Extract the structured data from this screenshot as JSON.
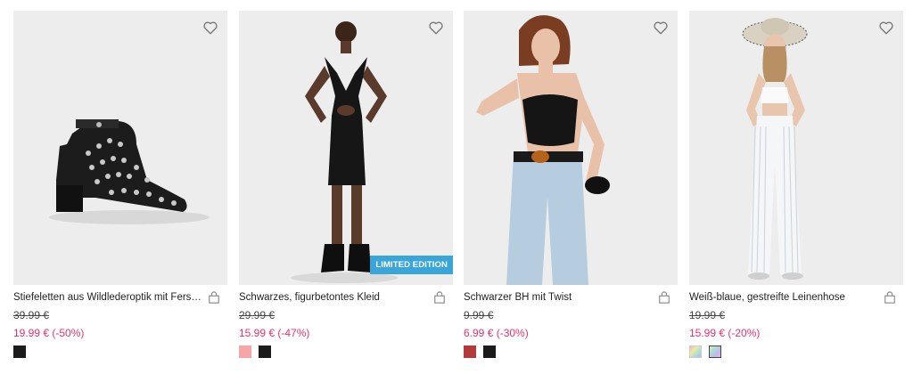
{
  "products": [
    {
      "title": "Stiefeletten aus Wildlederoptik mit Fersenri...",
      "old_price": "39.99 €",
      "new_price": "19.99 € (-50%)",
      "image_icon": "ankle-boot-photo",
      "swatches": [
        "#1b1b1b"
      ]
    },
    {
      "title": "Schwarzes, figurbetontes Kleid",
      "old_price": "29.99 €",
      "new_price": "15.99 € (-47%)",
      "badge": "LIMITED EDITION",
      "image_icon": "black-dress-photo",
      "swatches": [
        "#f6a6a6",
        "#1b1b1b"
      ]
    },
    {
      "title": "Schwarzer BH mit Twist",
      "old_price": "9.99 €",
      "new_price": "6.99 € (-30%)",
      "image_icon": "black-bra-photo",
      "swatches": [
        "#b33a3a",
        "#1b1b1b"
      ]
    },
    {
      "title": "Weiß-blaue, gestreifte Leinenhose",
      "old_price": "19.99 €",
      "new_price": "15.99 € (-20%)",
      "image_icon": "striped-trousers-photo",
      "swatches": [
        "iridescent",
        "iridescent"
      ]
    }
  ],
  "colors": {
    "accent_price": "#e8336b",
    "badge_bg": "#3aa6d8",
    "photo_bg": "#eeeeee"
  },
  "icons": {
    "wishlist": "heart-icon",
    "cart": "shopping-bag-icon"
  }
}
